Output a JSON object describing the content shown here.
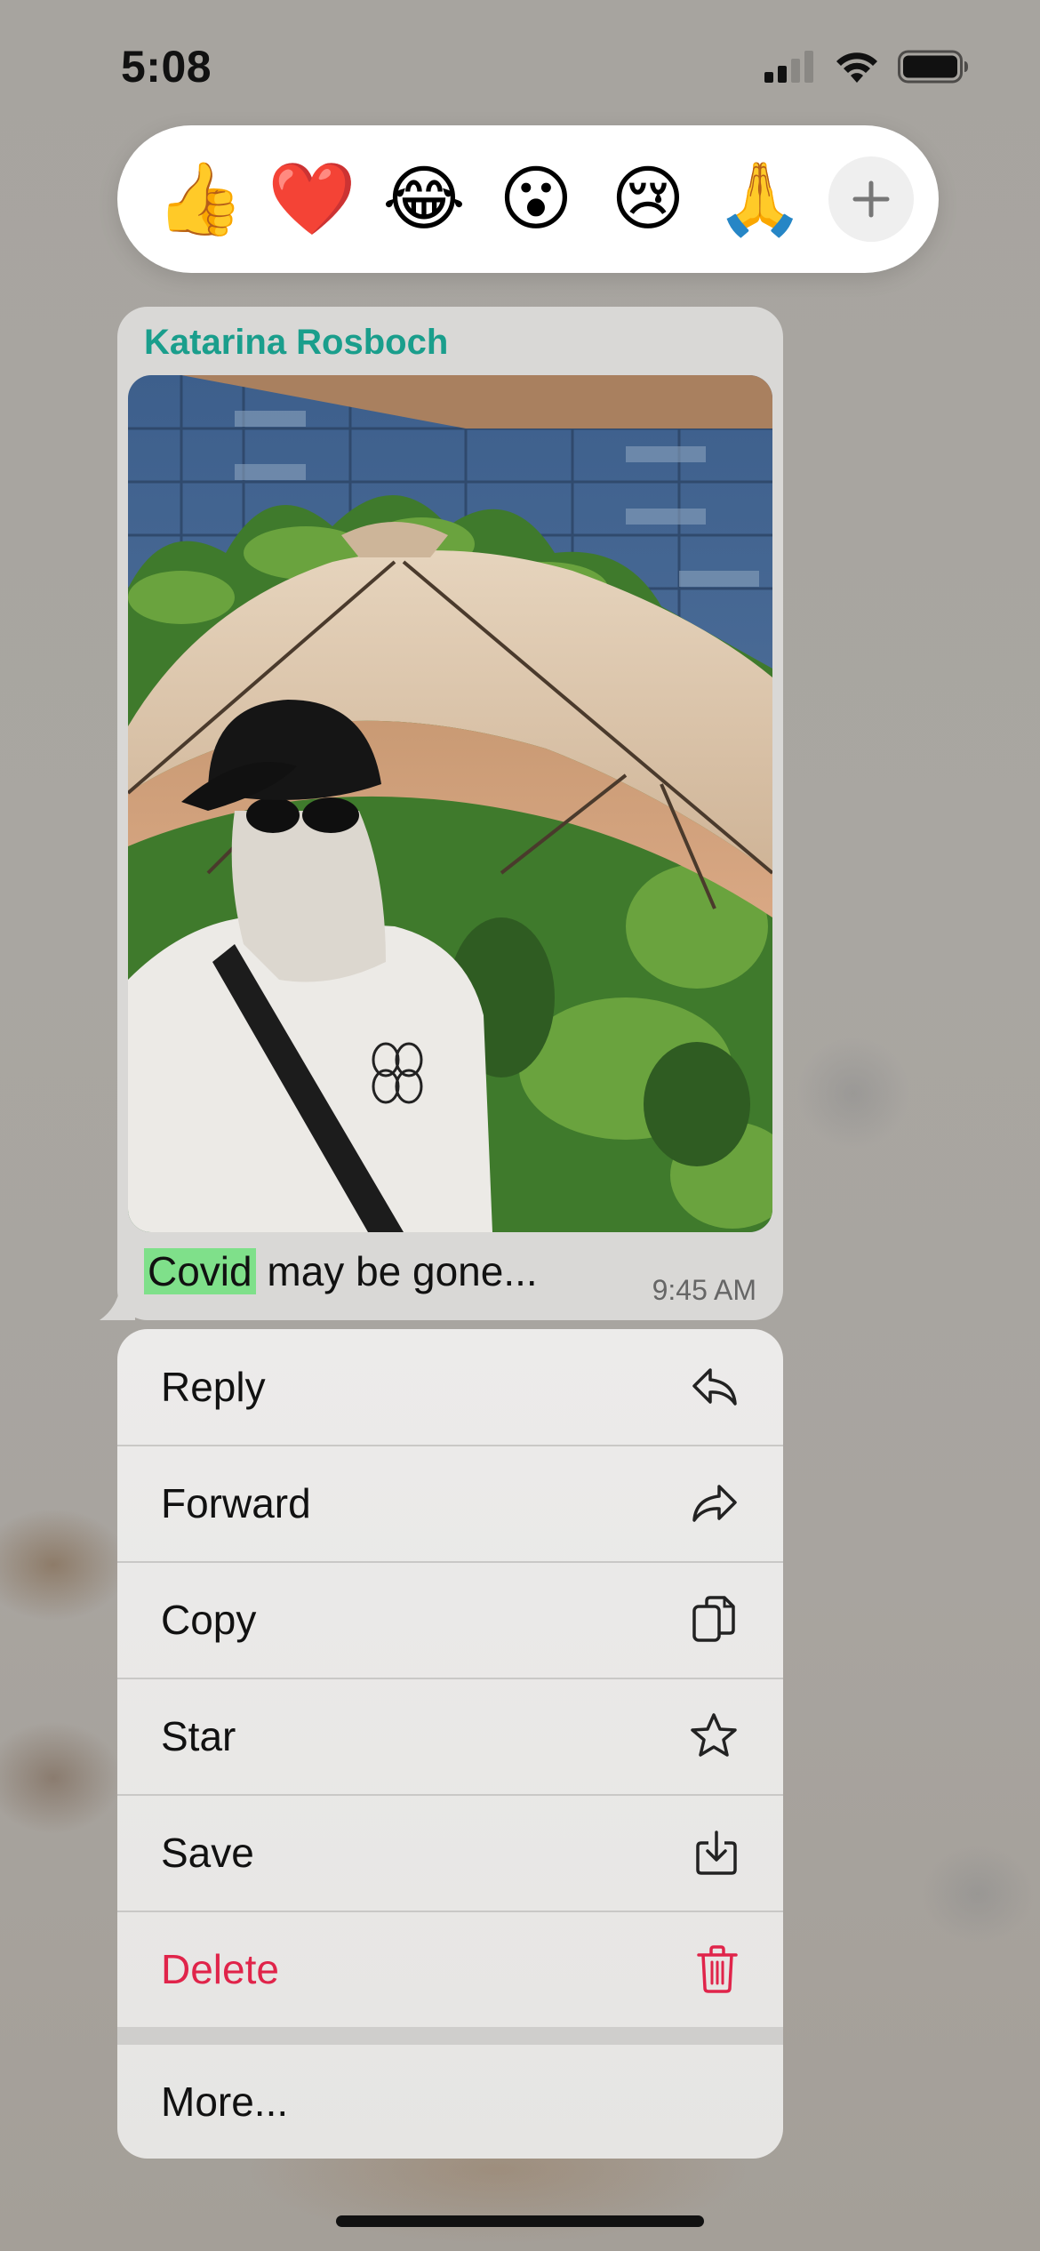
{
  "status_bar": {
    "time": "5:08",
    "icons": [
      "cellular-signal-icon",
      "wifi-icon",
      "battery-icon"
    ]
  },
  "reactions": [
    {
      "emoji": "👍",
      "name": "thumbs-up"
    },
    {
      "emoji": "❤️",
      "name": "heart"
    },
    {
      "emoji": "😂",
      "name": "tears-of-joy"
    },
    {
      "emoji": "😮",
      "name": "surprised"
    },
    {
      "emoji": "😢",
      "name": "crying"
    },
    {
      "emoji": "🙏",
      "name": "pray"
    }
  ],
  "message": {
    "sender": "Katarina Rosboch",
    "caption_highlight": "Covid",
    "caption_rest": " may be gone...",
    "time": "9:45 AM",
    "sender_color": "#1a9e8c",
    "highlight_color": "#7fe08a"
  },
  "menu": {
    "items": [
      {
        "label": "Reply",
        "icon": "reply-icon"
      },
      {
        "label": "Forward",
        "icon": "forward-icon"
      },
      {
        "label": "Copy",
        "icon": "copy-icon"
      },
      {
        "label": "Star",
        "icon": "star-icon"
      },
      {
        "label": "Save",
        "icon": "save-icon"
      },
      {
        "label": "Delete",
        "icon": "trash-icon",
        "color": "#e0244a"
      }
    ],
    "more_label": "More..."
  }
}
